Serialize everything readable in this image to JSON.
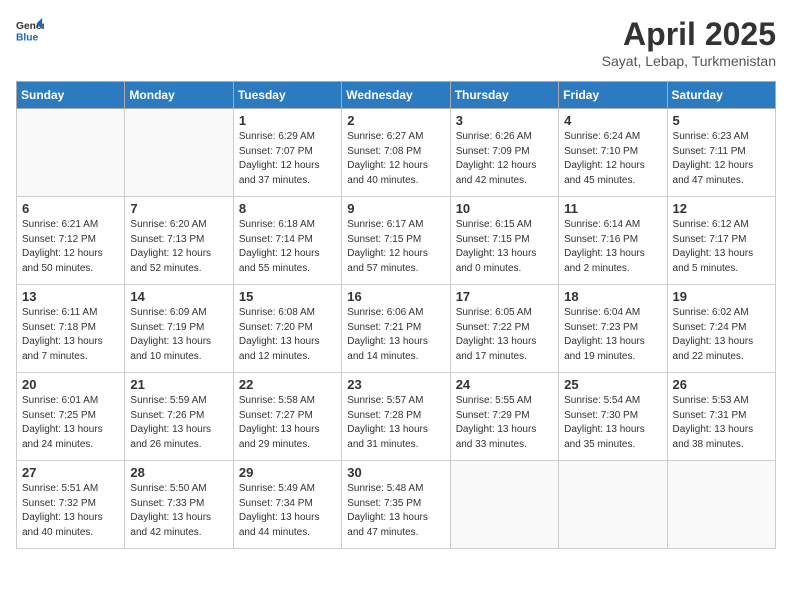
{
  "header": {
    "logo_line1": "General",
    "logo_line2": "Blue",
    "month_title": "April 2025",
    "subtitle": "Sayat, Lebap, Turkmenistan"
  },
  "weekdays": [
    "Sunday",
    "Monday",
    "Tuesday",
    "Wednesday",
    "Thursday",
    "Friday",
    "Saturday"
  ],
  "weeks": [
    [
      {
        "day": "",
        "info": ""
      },
      {
        "day": "",
        "info": ""
      },
      {
        "day": "1",
        "info": "Sunrise: 6:29 AM\nSunset: 7:07 PM\nDaylight: 12 hours\nand 37 minutes."
      },
      {
        "day": "2",
        "info": "Sunrise: 6:27 AM\nSunset: 7:08 PM\nDaylight: 12 hours\nand 40 minutes."
      },
      {
        "day": "3",
        "info": "Sunrise: 6:26 AM\nSunset: 7:09 PM\nDaylight: 12 hours\nand 42 minutes."
      },
      {
        "day": "4",
        "info": "Sunrise: 6:24 AM\nSunset: 7:10 PM\nDaylight: 12 hours\nand 45 minutes."
      },
      {
        "day": "5",
        "info": "Sunrise: 6:23 AM\nSunset: 7:11 PM\nDaylight: 12 hours\nand 47 minutes."
      }
    ],
    [
      {
        "day": "6",
        "info": "Sunrise: 6:21 AM\nSunset: 7:12 PM\nDaylight: 12 hours\nand 50 minutes."
      },
      {
        "day": "7",
        "info": "Sunrise: 6:20 AM\nSunset: 7:13 PM\nDaylight: 12 hours\nand 52 minutes."
      },
      {
        "day": "8",
        "info": "Sunrise: 6:18 AM\nSunset: 7:14 PM\nDaylight: 12 hours\nand 55 minutes."
      },
      {
        "day": "9",
        "info": "Sunrise: 6:17 AM\nSunset: 7:15 PM\nDaylight: 12 hours\nand 57 minutes."
      },
      {
        "day": "10",
        "info": "Sunrise: 6:15 AM\nSunset: 7:15 PM\nDaylight: 13 hours\nand 0 minutes."
      },
      {
        "day": "11",
        "info": "Sunrise: 6:14 AM\nSunset: 7:16 PM\nDaylight: 13 hours\nand 2 minutes."
      },
      {
        "day": "12",
        "info": "Sunrise: 6:12 AM\nSunset: 7:17 PM\nDaylight: 13 hours\nand 5 minutes."
      }
    ],
    [
      {
        "day": "13",
        "info": "Sunrise: 6:11 AM\nSunset: 7:18 PM\nDaylight: 13 hours\nand 7 minutes."
      },
      {
        "day": "14",
        "info": "Sunrise: 6:09 AM\nSunset: 7:19 PM\nDaylight: 13 hours\nand 10 minutes."
      },
      {
        "day": "15",
        "info": "Sunrise: 6:08 AM\nSunset: 7:20 PM\nDaylight: 13 hours\nand 12 minutes."
      },
      {
        "day": "16",
        "info": "Sunrise: 6:06 AM\nSunset: 7:21 PM\nDaylight: 13 hours\nand 14 minutes."
      },
      {
        "day": "17",
        "info": "Sunrise: 6:05 AM\nSunset: 7:22 PM\nDaylight: 13 hours\nand 17 minutes."
      },
      {
        "day": "18",
        "info": "Sunrise: 6:04 AM\nSunset: 7:23 PM\nDaylight: 13 hours\nand 19 minutes."
      },
      {
        "day": "19",
        "info": "Sunrise: 6:02 AM\nSunset: 7:24 PM\nDaylight: 13 hours\nand 22 minutes."
      }
    ],
    [
      {
        "day": "20",
        "info": "Sunrise: 6:01 AM\nSunset: 7:25 PM\nDaylight: 13 hours\nand 24 minutes."
      },
      {
        "day": "21",
        "info": "Sunrise: 5:59 AM\nSunset: 7:26 PM\nDaylight: 13 hours\nand 26 minutes."
      },
      {
        "day": "22",
        "info": "Sunrise: 5:58 AM\nSunset: 7:27 PM\nDaylight: 13 hours\nand 29 minutes."
      },
      {
        "day": "23",
        "info": "Sunrise: 5:57 AM\nSunset: 7:28 PM\nDaylight: 13 hours\nand 31 minutes."
      },
      {
        "day": "24",
        "info": "Sunrise: 5:55 AM\nSunset: 7:29 PM\nDaylight: 13 hours\nand 33 minutes."
      },
      {
        "day": "25",
        "info": "Sunrise: 5:54 AM\nSunset: 7:30 PM\nDaylight: 13 hours\nand 35 minutes."
      },
      {
        "day": "26",
        "info": "Sunrise: 5:53 AM\nSunset: 7:31 PM\nDaylight: 13 hours\nand 38 minutes."
      }
    ],
    [
      {
        "day": "27",
        "info": "Sunrise: 5:51 AM\nSunset: 7:32 PM\nDaylight: 13 hours\nand 40 minutes."
      },
      {
        "day": "28",
        "info": "Sunrise: 5:50 AM\nSunset: 7:33 PM\nDaylight: 13 hours\nand 42 minutes."
      },
      {
        "day": "29",
        "info": "Sunrise: 5:49 AM\nSunset: 7:34 PM\nDaylight: 13 hours\nand 44 minutes."
      },
      {
        "day": "30",
        "info": "Sunrise: 5:48 AM\nSunset: 7:35 PM\nDaylight: 13 hours\nand 47 minutes."
      },
      {
        "day": "",
        "info": ""
      },
      {
        "day": "",
        "info": ""
      },
      {
        "day": "",
        "info": ""
      }
    ]
  ]
}
